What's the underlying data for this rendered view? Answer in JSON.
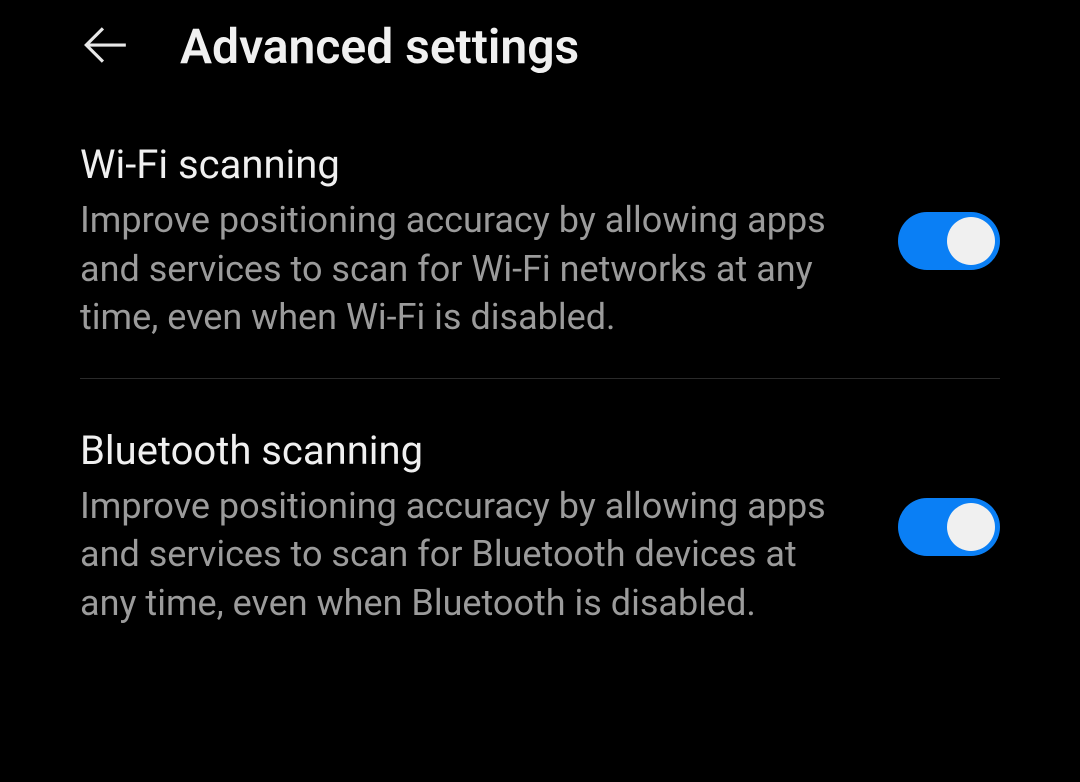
{
  "header": {
    "title": "Advanced settings"
  },
  "settings": [
    {
      "title": "Wi-Fi scanning",
      "description": "Improve positioning accuracy by allowing apps and services to scan for Wi-Fi networks at any time, even when Wi-Fi is disabled.",
      "enabled": true
    },
    {
      "title": "Bluetooth scanning",
      "description": "Improve positioning accuracy by allowing apps and services to scan for Bluetooth devices at any time, even when Bluetooth is disabled.",
      "enabled": true
    }
  ],
  "colors": {
    "accent": "#0a7ff5",
    "background": "#000000",
    "text_primary": "#f0f0f0",
    "text_secondary": "#9b9b9b"
  }
}
